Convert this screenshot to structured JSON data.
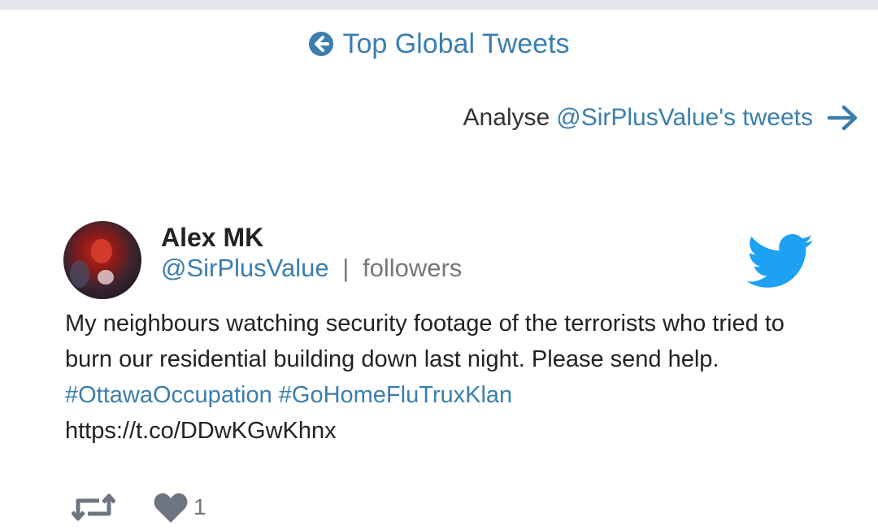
{
  "header": {
    "back_label": "Top Global Tweets",
    "back_icon": "circle-arrow-left-icon"
  },
  "analyse": {
    "prefix": "Analyse",
    "handle_link": "@SirPlusValue's tweets",
    "arrow_icon": "arrow-right-icon"
  },
  "tweet": {
    "author_name": "Alex MK",
    "handle": "@SirPlusValue",
    "separator": "|",
    "followers_label": "followers",
    "platform_icon": "twitter-bird-icon",
    "text_line": "My neighbours watching security footage of the terrorists who tried to burn our residential building down last night. Please send help.",
    "hashtags": [
      "#OttawaOccupation",
      "#GoHomeFluTruxKlan"
    ],
    "link": "https://t.co/DDwKGwKhnx",
    "retweet_icon": "retweet-icon",
    "like_icon": "heart-icon",
    "like_count": "1"
  },
  "colors": {
    "accent": "#3b7eae",
    "twitter_blue": "#1da1f2",
    "icon_gray": "#6d7680"
  }
}
